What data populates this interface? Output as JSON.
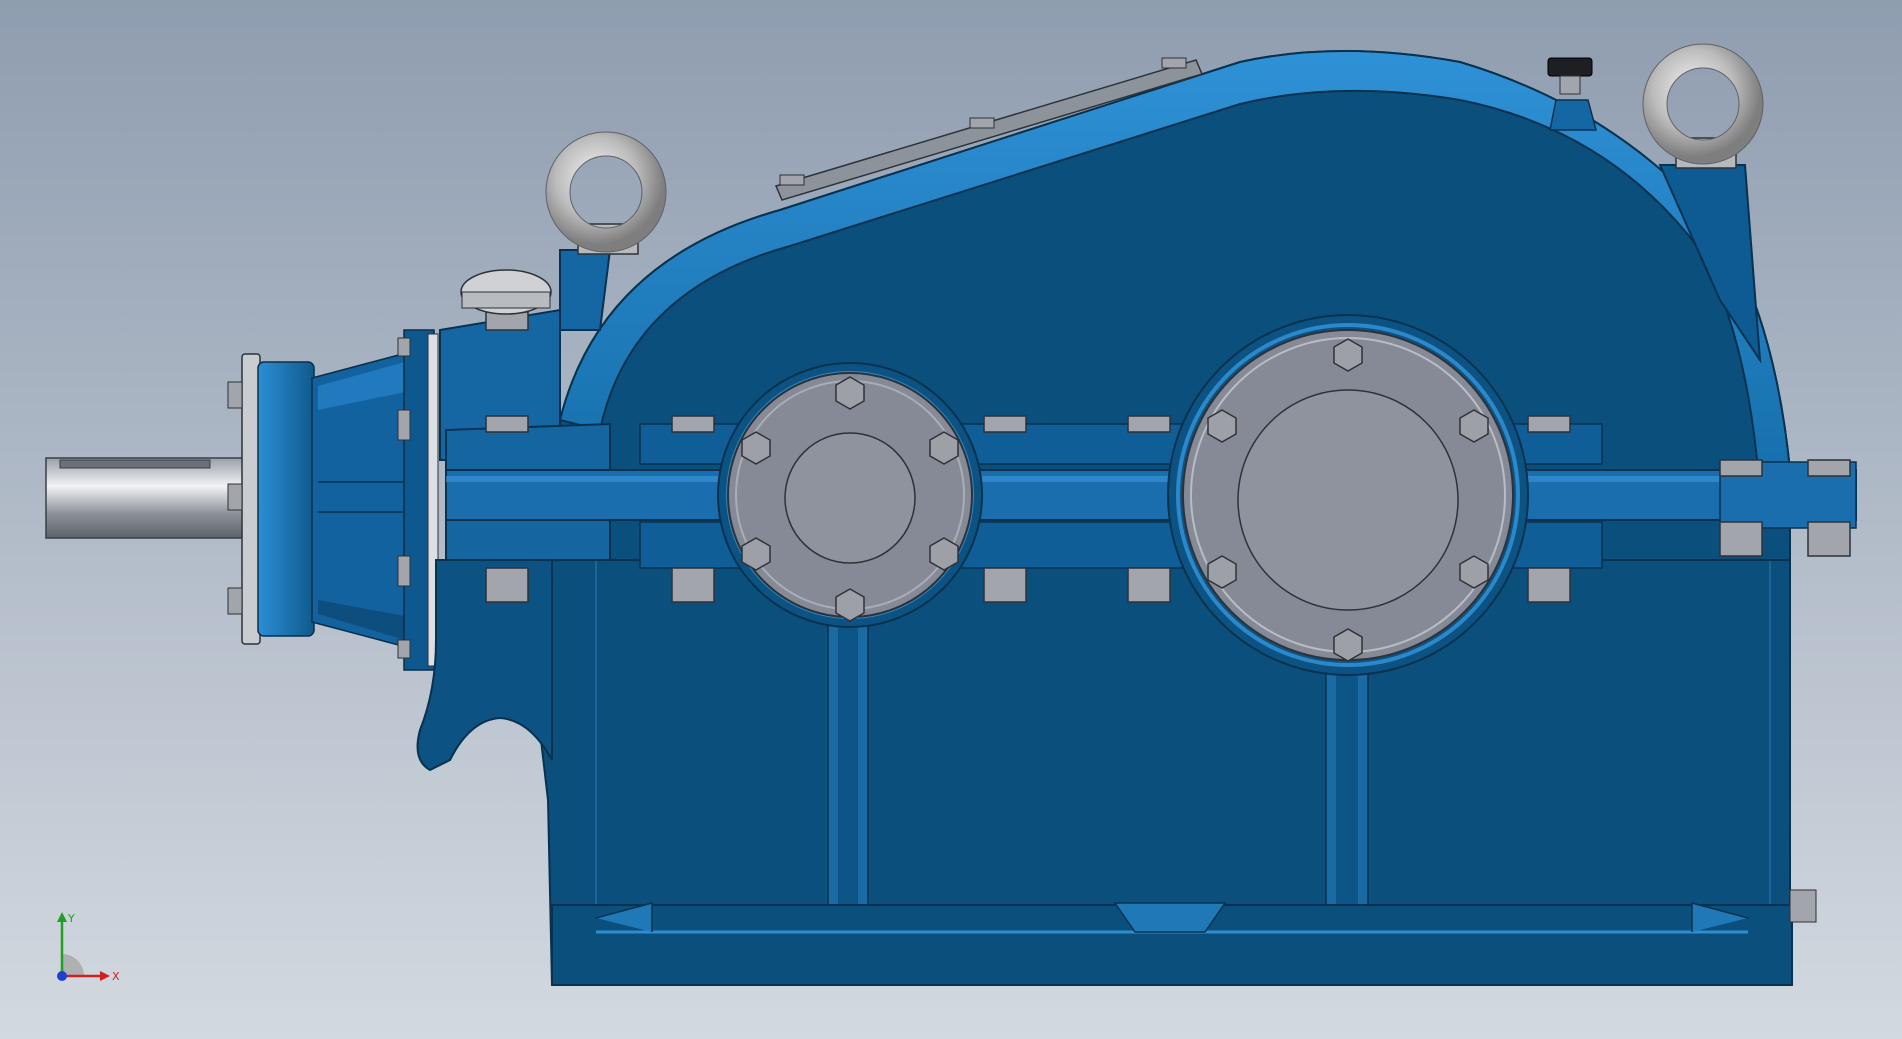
{
  "window": {
    "title": ""
  },
  "model": {
    "name": "",
    "view": "front",
    "colors": {
      "housing_dark": "#0b4f7c",
      "housing_mid": "#1c6fa6",
      "housing_light": "#2f8dd1",
      "cover_grey": "#8a8e99",
      "bolt_grey": "#9a9da4",
      "eyebolt_silver": "#c9c9c9",
      "background_top": "#8f9db0",
      "background_bottom": "#d3d9e0"
    }
  },
  "triad": {
    "x_label": "X",
    "y_label": "Y",
    "colors": {
      "x": "#d21f1f",
      "y": "#21a121",
      "z": "#1f3fd2"
    }
  }
}
